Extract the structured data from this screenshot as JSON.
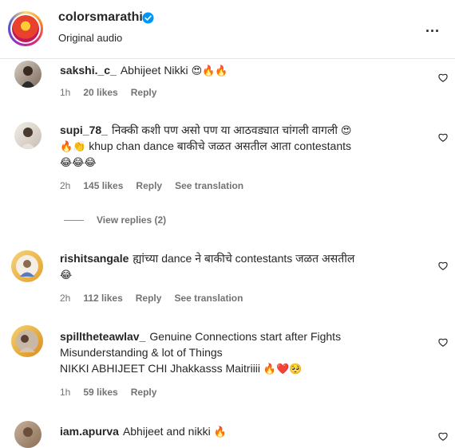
{
  "header": {
    "username": "colorsmarathi",
    "subtitle": "Original audio",
    "more_label": "..."
  },
  "comments": [
    {
      "username": "sakshi._c_",
      "text": "Abhijeet Nikki",
      "emojis": "😍🔥🔥",
      "time": "1h",
      "likes": "20 likes",
      "reply": "Reply"
    },
    {
      "username": "supi_78_",
      "text_line1": "निक्की कशी पण असो पण या आठवड्यात चांगली वागली",
      "line1_emoji": "😍",
      "line2_emojis": "🔥👏",
      "text_line2": "khup chan dance बाकीचे जळत असतील आता contestants",
      "line3_emojis": "😂😂😂",
      "time": "2h",
      "likes": "145 likes",
      "reply": "Reply",
      "translation": "See translation",
      "view_replies": "View replies (2)"
    },
    {
      "username": "rishitsangale",
      "text": "ह्यांच्या dance ने बाकीचे contestants जळत असतील",
      "emojis": "😂",
      "time": "2h",
      "likes": "112 likes",
      "reply": "Reply",
      "translation": "See translation"
    },
    {
      "username": "spilltheteawlav_",
      "text_line1": "Genuine Connections start after Fights",
      "text_line2": "Misunderstanding & lot of Things",
      "text_line3": "NIKKI ABHIJEET CHI Jhakkasss Maitriiii",
      "emojis": "🔥❤️🥺",
      "time": "1h",
      "likes": "59 likes",
      "reply": "Reply"
    },
    {
      "username": "iam.apurva",
      "text": "Abhijeet and nikki",
      "emojis": "🔥"
    }
  ]
}
